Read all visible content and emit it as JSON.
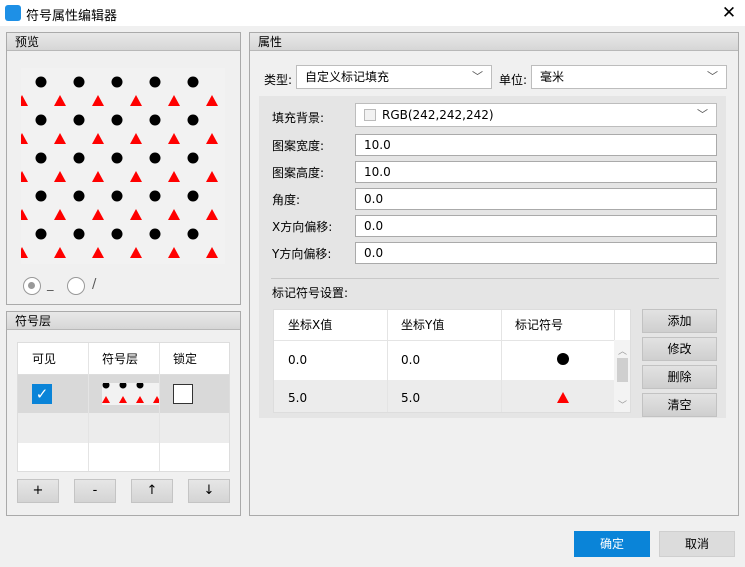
{
  "window": {
    "title": "符号属性编辑器",
    "close_glyph": "✕",
    "icon": "app-logo-icon"
  },
  "preview": {
    "title": "预览",
    "radio_line_label": "_",
    "radio_slash_label": "/",
    "selected_radio": "line"
  },
  "layers": {
    "title": "符号层",
    "columns": [
      "可见",
      "符号层",
      "锁定"
    ],
    "rows": [
      {
        "visible": true,
        "locked": false
      }
    ],
    "buttons": {
      "add": "+",
      "remove": "-",
      "up": "↑",
      "down": "↓"
    }
  },
  "properties": {
    "title": "属性",
    "type_label": "类型:",
    "type_value": "自定义标记填充",
    "unit_label": "单位:",
    "unit_value": "毫米",
    "fill_bg_label": "填充背景:",
    "fill_bg_value": "RGB(242,242,242)",
    "fill_bg_color": "#f2f2f2",
    "width_label": "图案宽度:",
    "width_value": "10.0",
    "height_label": "图案高度:",
    "height_value": "10.0",
    "angle_label": "角度:",
    "angle_value": "0.0",
    "xoff_label": "X方向偏移:",
    "xoff_value": "0.0",
    "yoff_label": "Y方向偏移:",
    "yoff_value": "0.0"
  },
  "marker_settings": {
    "title": "标记符号设置:",
    "columns": [
      "坐标X值",
      "坐标Y值",
      "标记符号"
    ],
    "rows": [
      {
        "x": "0.0",
        "y": "0.0",
        "symbol": "black-circle",
        "color": "#000000"
      },
      {
        "x": "5.0",
        "y": "5.0",
        "symbol": "red-triangle",
        "color": "#ff0000"
      }
    ],
    "buttons": {
      "add": "添加",
      "edit": "修改",
      "delete": "删除",
      "clear": "清空"
    }
  },
  "footer": {
    "ok": "确定",
    "cancel": "取消"
  },
  "colors": {
    "accent": "#0a84d8",
    "marker_red": "#ff0000",
    "marker_black": "#000000"
  }
}
